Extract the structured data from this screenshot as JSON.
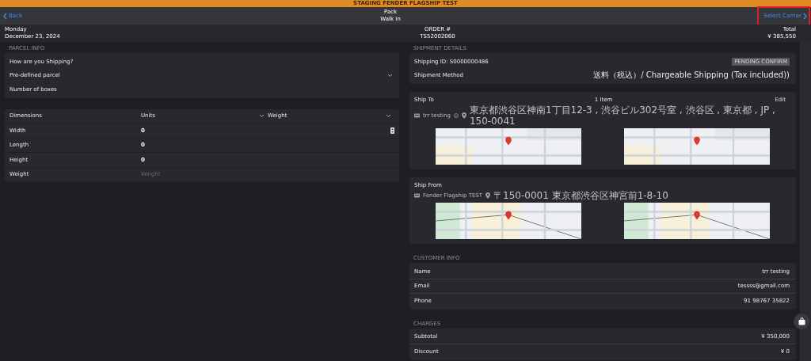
{
  "banner": "STAGING FENDER FLAGSHIP TEST",
  "header": {
    "back": "Back",
    "title": "Pack",
    "subtitle": "Walk In",
    "action": "Select Carrier"
  },
  "info_bar": {
    "day": "Monday",
    "date": "December 23, 2024",
    "order_label": "ORDER #",
    "order_number": "TS52002060",
    "total_label": "Total",
    "total": "¥ 385,550"
  },
  "parcel_info": {
    "heading": "PARCEL INFO",
    "question": "How are you Shipping?",
    "parcel_type": "Pre-defined parcel",
    "boxes_label": "Number of boxes"
  },
  "dimensions": {
    "columns": [
      "Dimensions",
      "Units",
      "Weight"
    ],
    "rows": [
      {
        "label": "Width",
        "value": "0",
        "kind": "spin"
      },
      {
        "label": "Length",
        "value": "0",
        "kind": "plain"
      },
      {
        "label": "Height",
        "value": "0",
        "kind": "plain"
      },
      {
        "label": "Weight",
        "placeholder": "Weight",
        "kind": "plain"
      }
    ]
  },
  "shipment_details": {
    "heading": "SHIPMENT DETAILS",
    "shipping_id": "Shipping ID: S0000000486",
    "status": "PENDING CONFIRM",
    "method_label": "Shipment Method",
    "method": "送料（税込）/ Chargeable Shipping (Tax included))"
  },
  "ship_to": {
    "title": "Ship To",
    "items": "1 Item",
    "edit": "Edit",
    "name": "trr testing",
    "address": "東京都渋谷区神南1丁目12-3 , 渋谷ビル302号室 , 渋谷区 , 東京都 , JP , 150-0041"
  },
  "ship_from": {
    "title": "Ship From",
    "name": "Fender Flagship TEST",
    "address": "〒150-0001 東京都渋谷区神宮前1-8-10"
  },
  "customer_info": {
    "heading": "CUSTOMER INFO",
    "rows": [
      {
        "label": "Name",
        "value": "trr testing"
      },
      {
        "label": "Email",
        "value": "tessss@gmail.com"
      },
      {
        "label": "Phone",
        "value": "91 98767 35822"
      }
    ]
  },
  "charges": {
    "heading": "CHARGES",
    "rows": [
      {
        "label": "Subtotal",
        "value": "¥ 350,000"
      },
      {
        "label": "Discount",
        "value": "¥ 0"
      }
    ]
  }
}
